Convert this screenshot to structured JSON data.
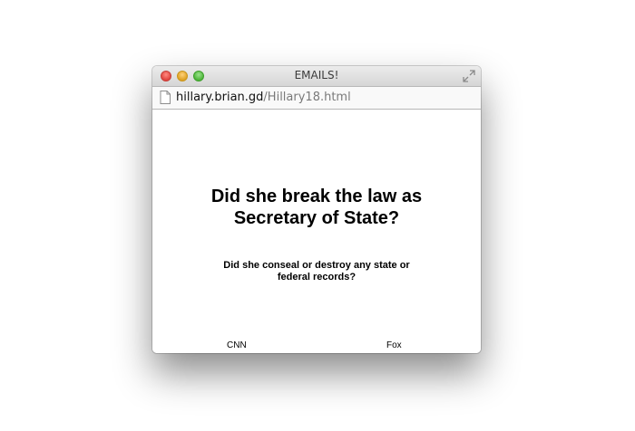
{
  "window": {
    "title": "EMAILS!"
  },
  "address_bar": {
    "host": "hillary.brian.gd",
    "path": "/Hillary18.html"
  },
  "content": {
    "headline": "Did she break the law as Secretary of State?",
    "subheadline": "Did she conseal or destroy any state or federal records?"
  },
  "footer": {
    "left_link": "CNN",
    "right_link": "Fox"
  },
  "icons": {
    "close": "close-icon",
    "minimize": "minimize-icon",
    "maximize": "maximize-icon",
    "fullscreen": "fullscreen-icon",
    "document": "document-icon"
  },
  "colors": {
    "close": "#e0443e",
    "minimize": "#dea123",
    "maximize": "#4db53a",
    "url_path": "#7a7a7a"
  }
}
